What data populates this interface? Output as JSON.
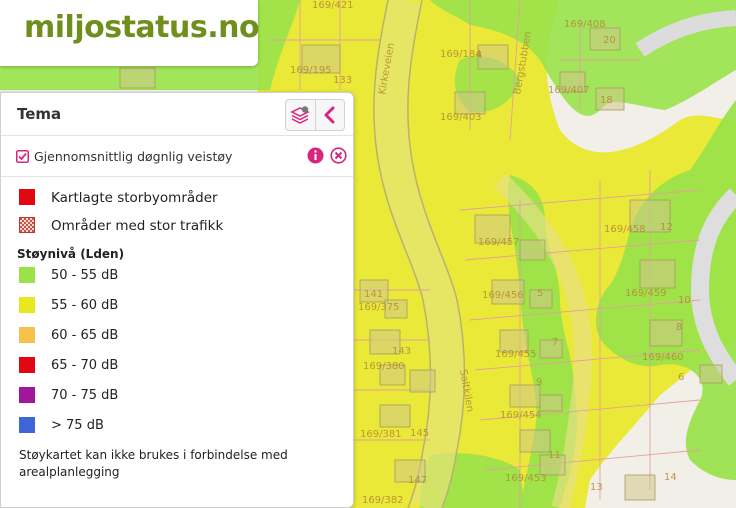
{
  "logo": {
    "text": "miljostatus.no",
    "color": "#6f8e1c"
  },
  "panel": {
    "title": "Tema",
    "buttons": [
      {
        "name": "layers-icon",
        "color": "#d6267e"
      },
      {
        "name": "collapse-chevron-icon",
        "color": "#d6267e"
      }
    ],
    "layer": {
      "name": "Gjennomsnittlig døgnlig veistøy",
      "checked": true,
      "info_icon": "info-icon",
      "remove_icon": "remove-icon",
      "accent_color": "#d6267e"
    },
    "legend_top": [
      {
        "label": "Kartlagte storbyområder",
        "color": "#e30613",
        "pattern": "solid"
      },
      {
        "label": "Områder med stor trafikk",
        "color": "#c0392b",
        "pattern": "crosshatch"
      }
    ],
    "section_title": "Støynivå (Lden)",
    "levels": [
      {
        "label": "50 - 55 dB",
        "color": "#99e24a"
      },
      {
        "label": "55 - 60 dB",
        "color": "#e8e81e"
      },
      {
        "label": "60 - 65 dB",
        "color": "#f7c24a"
      },
      {
        "label": "65 - 70 dB",
        "color": "#e30613"
      },
      {
        "label": "70 - 75 dB",
        "color": "#a1169b"
      },
      {
        "label": "> 75 dB",
        "color": "#3d66d6"
      }
    ],
    "note": "Støykartet kan ikke brukes i forbindelse med arealplanlegging"
  },
  "map": {
    "colors": {
      "base": "#f2efe9",
      "zone_yellow": "#e8e81e",
      "zone_green": "#99e24a",
      "building": "#d8d0a8",
      "road_edge": "#c9c1a0",
      "property_line": "#e3a0a0"
    },
    "street_labels": [
      "Kirkeveien",
      "Bergstubben",
      "Saltkilen"
    ],
    "address_labels": [
      "169/421",
      "169/184",
      "169/195",
      "169/403",
      "169/408",
      "169/407",
      "20",
      "18",
      "4",
      "133",
      "169/457",
      "169/456",
      "169/455",
      "169/454",
      "169/453",
      "169/459",
      "169/460",
      "169/458",
      "169/375",
      "169/380",
      "169/381",
      "169/382",
      "141",
      "143",
      "145",
      "147",
      "5",
      "7",
      "9",
      "11",
      "13",
      "12",
      "10",
      "8",
      "6",
      "14"
    ]
  }
}
